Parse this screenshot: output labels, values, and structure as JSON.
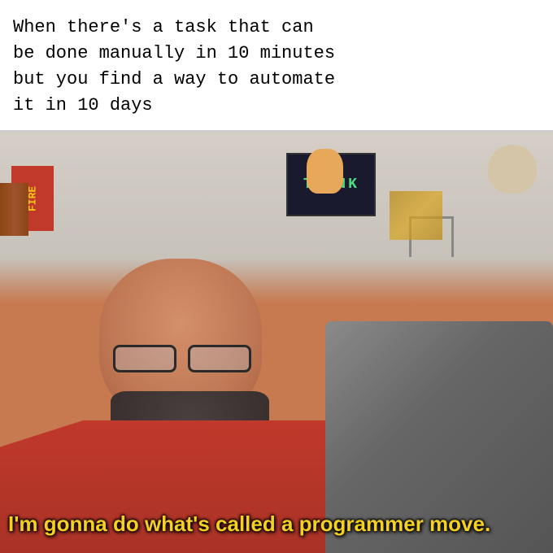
{
  "meme": {
    "top_text": "When there's a task that can\nbe done manually in 10 minutes\nbut you find a way to automate\nit in 10 days",
    "caption": "I'm gonna do what's called a programmer move.",
    "fire_label": "FIRE",
    "think_label": "THINK",
    "bg_color": "#ffffff",
    "caption_color": "#f5d020"
  }
}
